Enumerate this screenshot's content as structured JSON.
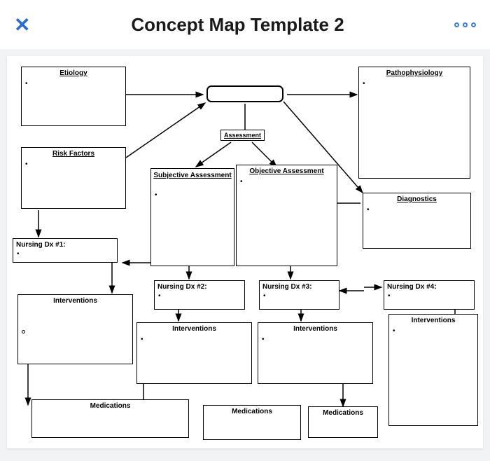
{
  "header": {
    "close_label": "✕",
    "title": "Concept Map Template 2"
  },
  "boxes": {
    "etiology": "Etiology",
    "pathophysiology": "Pathophysiology",
    "assessment": "Assessment",
    "risk_factors": "Risk Factors",
    "subjective": "Subjective Assessment",
    "objective": "Objective Assessment",
    "diagnostics": "Diagnostics",
    "dx1": "Nursing Dx #1:",
    "dx2": "Nursing Dx #2:",
    "dx3": "Nursing Dx #3:",
    "dx4": "Nursing Dx #4:",
    "interv": "Interventions",
    "meds": "Medications"
  }
}
